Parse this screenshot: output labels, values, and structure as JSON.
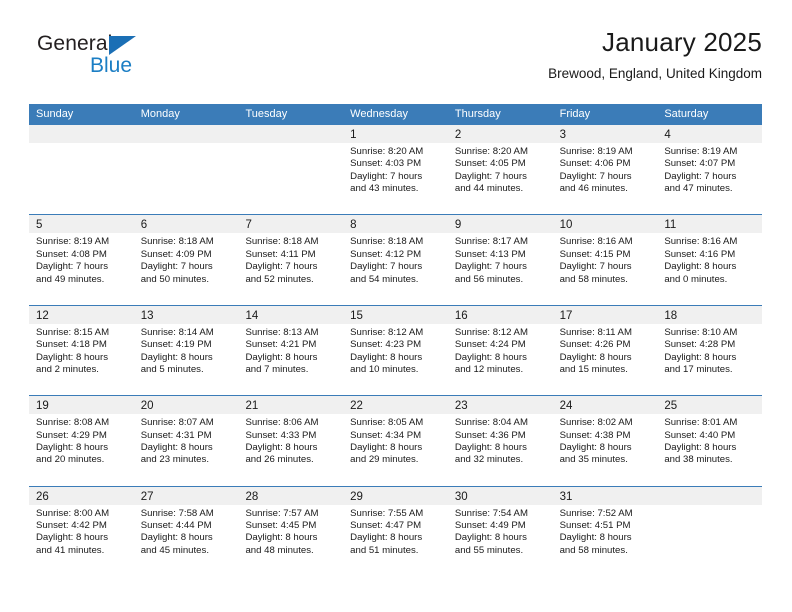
{
  "brand": {
    "name_top": "General",
    "name_bottom": "Blue",
    "accent_color": "#1b7ec4",
    "triangle_color": "#1b6fb5"
  },
  "header": {
    "title": "January 2025",
    "subtitle": "Brewood, England, United Kingdom"
  },
  "theme": {
    "header_blue": "#3b7cb8",
    "day_band_gray": "#f0f0f0",
    "text": "#1a1a1a"
  },
  "calendar": {
    "weekdays": [
      "Sunday",
      "Monday",
      "Tuesday",
      "Wednesday",
      "Thursday",
      "Friday",
      "Saturday"
    ],
    "weeks": [
      [
        {
          "day": "",
          "sunrise": "",
          "sunset": "",
          "daylight_line1": "",
          "daylight_line2": "",
          "empty": true
        },
        {
          "day": "",
          "sunrise": "",
          "sunset": "",
          "daylight_line1": "",
          "daylight_line2": "",
          "empty": true
        },
        {
          "day": "",
          "sunrise": "",
          "sunset": "",
          "daylight_line1": "",
          "daylight_line2": "",
          "empty": true
        },
        {
          "day": "1",
          "sunrise": "Sunrise: 8:20 AM",
          "sunset": "Sunset: 4:03 PM",
          "daylight_line1": "Daylight: 7 hours",
          "daylight_line2": "and 43 minutes."
        },
        {
          "day": "2",
          "sunrise": "Sunrise: 8:20 AM",
          "sunset": "Sunset: 4:05 PM",
          "daylight_line1": "Daylight: 7 hours",
          "daylight_line2": "and 44 minutes."
        },
        {
          "day": "3",
          "sunrise": "Sunrise: 8:19 AM",
          "sunset": "Sunset: 4:06 PM",
          "daylight_line1": "Daylight: 7 hours",
          "daylight_line2": "and 46 minutes."
        },
        {
          "day": "4",
          "sunrise": "Sunrise: 8:19 AM",
          "sunset": "Sunset: 4:07 PM",
          "daylight_line1": "Daylight: 7 hours",
          "daylight_line2": "and 47 minutes."
        }
      ],
      [
        {
          "day": "5",
          "sunrise": "Sunrise: 8:19 AM",
          "sunset": "Sunset: 4:08 PM",
          "daylight_line1": "Daylight: 7 hours",
          "daylight_line2": "and 49 minutes."
        },
        {
          "day": "6",
          "sunrise": "Sunrise: 8:18 AM",
          "sunset": "Sunset: 4:09 PM",
          "daylight_line1": "Daylight: 7 hours",
          "daylight_line2": "and 50 minutes."
        },
        {
          "day": "7",
          "sunrise": "Sunrise: 8:18 AM",
          "sunset": "Sunset: 4:11 PM",
          "daylight_line1": "Daylight: 7 hours",
          "daylight_line2": "and 52 minutes."
        },
        {
          "day": "8",
          "sunrise": "Sunrise: 8:18 AM",
          "sunset": "Sunset: 4:12 PM",
          "daylight_line1": "Daylight: 7 hours",
          "daylight_line2": "and 54 minutes."
        },
        {
          "day": "9",
          "sunrise": "Sunrise: 8:17 AM",
          "sunset": "Sunset: 4:13 PM",
          "daylight_line1": "Daylight: 7 hours",
          "daylight_line2": "and 56 minutes."
        },
        {
          "day": "10",
          "sunrise": "Sunrise: 8:16 AM",
          "sunset": "Sunset: 4:15 PM",
          "daylight_line1": "Daylight: 7 hours",
          "daylight_line2": "and 58 minutes."
        },
        {
          "day": "11",
          "sunrise": "Sunrise: 8:16 AM",
          "sunset": "Sunset: 4:16 PM",
          "daylight_line1": "Daylight: 8 hours",
          "daylight_line2": "and 0 minutes."
        }
      ],
      [
        {
          "day": "12",
          "sunrise": "Sunrise: 8:15 AM",
          "sunset": "Sunset: 4:18 PM",
          "daylight_line1": "Daylight: 8 hours",
          "daylight_line2": "and 2 minutes."
        },
        {
          "day": "13",
          "sunrise": "Sunrise: 8:14 AM",
          "sunset": "Sunset: 4:19 PM",
          "daylight_line1": "Daylight: 8 hours",
          "daylight_line2": "and 5 minutes."
        },
        {
          "day": "14",
          "sunrise": "Sunrise: 8:13 AM",
          "sunset": "Sunset: 4:21 PM",
          "daylight_line1": "Daylight: 8 hours",
          "daylight_line2": "and 7 minutes."
        },
        {
          "day": "15",
          "sunrise": "Sunrise: 8:12 AM",
          "sunset": "Sunset: 4:23 PM",
          "daylight_line1": "Daylight: 8 hours",
          "daylight_line2": "and 10 minutes."
        },
        {
          "day": "16",
          "sunrise": "Sunrise: 8:12 AM",
          "sunset": "Sunset: 4:24 PM",
          "daylight_line1": "Daylight: 8 hours",
          "daylight_line2": "and 12 minutes."
        },
        {
          "day": "17",
          "sunrise": "Sunrise: 8:11 AM",
          "sunset": "Sunset: 4:26 PM",
          "daylight_line1": "Daylight: 8 hours",
          "daylight_line2": "and 15 minutes."
        },
        {
          "day": "18",
          "sunrise": "Sunrise: 8:10 AM",
          "sunset": "Sunset: 4:28 PM",
          "daylight_line1": "Daylight: 8 hours",
          "daylight_line2": "and 17 minutes."
        }
      ],
      [
        {
          "day": "19",
          "sunrise": "Sunrise: 8:08 AM",
          "sunset": "Sunset: 4:29 PM",
          "daylight_line1": "Daylight: 8 hours",
          "daylight_line2": "and 20 minutes."
        },
        {
          "day": "20",
          "sunrise": "Sunrise: 8:07 AM",
          "sunset": "Sunset: 4:31 PM",
          "daylight_line1": "Daylight: 8 hours",
          "daylight_line2": "and 23 minutes."
        },
        {
          "day": "21",
          "sunrise": "Sunrise: 8:06 AM",
          "sunset": "Sunset: 4:33 PM",
          "daylight_line1": "Daylight: 8 hours",
          "daylight_line2": "and 26 minutes."
        },
        {
          "day": "22",
          "sunrise": "Sunrise: 8:05 AM",
          "sunset": "Sunset: 4:34 PM",
          "daylight_line1": "Daylight: 8 hours",
          "daylight_line2": "and 29 minutes."
        },
        {
          "day": "23",
          "sunrise": "Sunrise: 8:04 AM",
          "sunset": "Sunset: 4:36 PM",
          "daylight_line1": "Daylight: 8 hours",
          "daylight_line2": "and 32 minutes."
        },
        {
          "day": "24",
          "sunrise": "Sunrise: 8:02 AM",
          "sunset": "Sunset: 4:38 PM",
          "daylight_line1": "Daylight: 8 hours",
          "daylight_line2": "and 35 minutes."
        },
        {
          "day": "25",
          "sunrise": "Sunrise: 8:01 AM",
          "sunset": "Sunset: 4:40 PM",
          "daylight_line1": "Daylight: 8 hours",
          "daylight_line2": "and 38 minutes."
        }
      ],
      [
        {
          "day": "26",
          "sunrise": "Sunrise: 8:00 AM",
          "sunset": "Sunset: 4:42 PM",
          "daylight_line1": "Daylight: 8 hours",
          "daylight_line2": "and 41 minutes."
        },
        {
          "day": "27",
          "sunrise": "Sunrise: 7:58 AM",
          "sunset": "Sunset: 4:44 PM",
          "daylight_line1": "Daylight: 8 hours",
          "daylight_line2": "and 45 minutes."
        },
        {
          "day": "28",
          "sunrise": "Sunrise: 7:57 AM",
          "sunset": "Sunset: 4:45 PM",
          "daylight_line1": "Daylight: 8 hours",
          "daylight_line2": "and 48 minutes."
        },
        {
          "day": "29",
          "sunrise": "Sunrise: 7:55 AM",
          "sunset": "Sunset: 4:47 PM",
          "daylight_line1": "Daylight: 8 hours",
          "daylight_line2": "and 51 minutes."
        },
        {
          "day": "30",
          "sunrise": "Sunrise: 7:54 AM",
          "sunset": "Sunset: 4:49 PM",
          "daylight_line1": "Daylight: 8 hours",
          "daylight_line2": "and 55 minutes."
        },
        {
          "day": "31",
          "sunrise": "Sunrise: 7:52 AM",
          "sunset": "Sunset: 4:51 PM",
          "daylight_line1": "Daylight: 8 hours",
          "daylight_line2": "and 58 minutes."
        },
        {
          "day": "",
          "sunrise": "",
          "sunset": "",
          "daylight_line1": "",
          "daylight_line2": "",
          "empty": true
        }
      ]
    ]
  }
}
